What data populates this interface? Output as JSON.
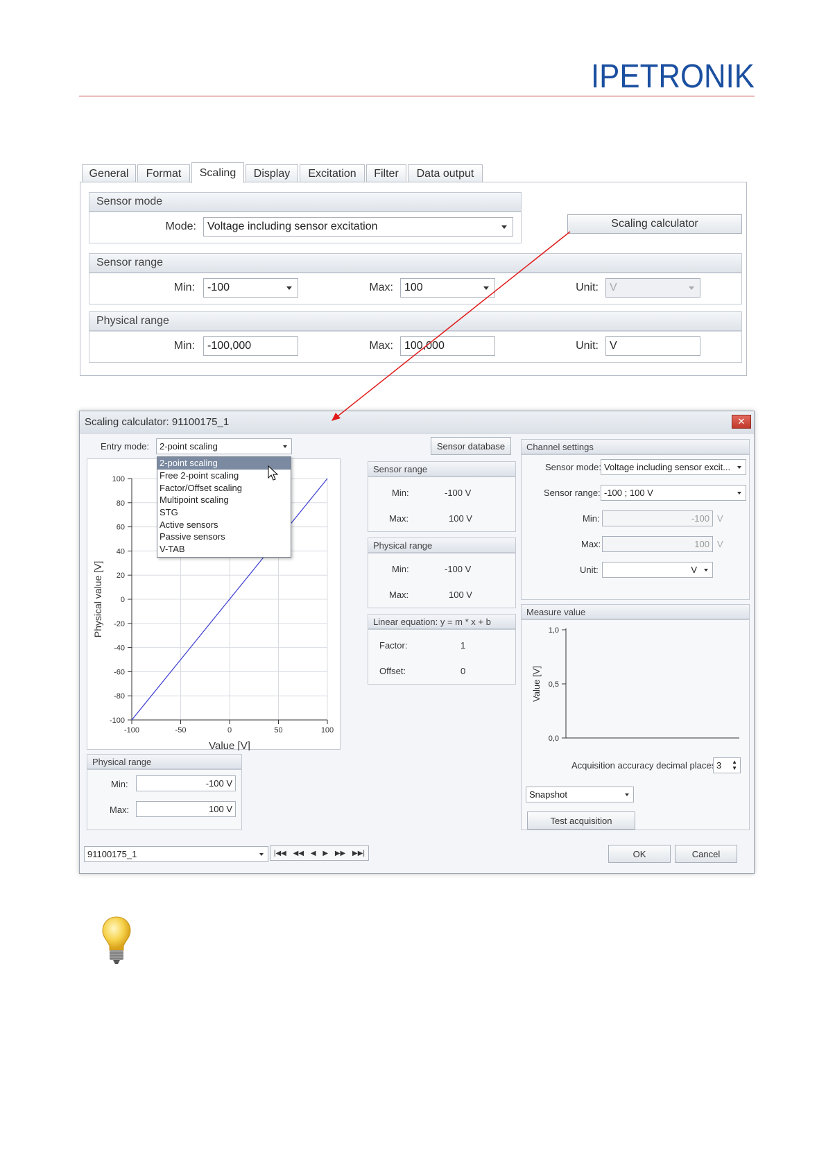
{
  "brand": {
    "logo_text": "IPETRONIK",
    "accent_color": "#1b4fa0",
    "rule_color": "#c44444"
  },
  "top_panel": {
    "tabs": [
      {
        "label": "General"
      },
      {
        "label": "Format"
      },
      {
        "label": "Scaling",
        "active": true
      },
      {
        "label": "Display"
      },
      {
        "label": "Excitation"
      },
      {
        "label": "Filter"
      },
      {
        "label": "Data output"
      }
    ],
    "sensor_mode": {
      "header": "Sensor mode",
      "mode_label": "Mode:",
      "mode_value": "Voltage including sensor excitation"
    },
    "scaling_calculator_button": "Scaling calculator",
    "sensor_range": {
      "header": "Sensor range",
      "min_label": "Min:",
      "min_value": "-100",
      "max_label": "Max:",
      "max_value": "100",
      "unit_label": "Unit:",
      "unit_value": "V"
    },
    "physical_range": {
      "header": "Physical range",
      "min_label": "Min:",
      "min_value": "-100,000",
      "max_label": "Max:",
      "max_value": "100,000",
      "unit_label": "Unit:",
      "unit_value": "V"
    }
  },
  "dialog": {
    "title": "Scaling calculator: 91100175_1",
    "close_icon": "close-icon",
    "entry_mode": {
      "label": "Entry mode:",
      "value": "2-point scaling",
      "options": [
        "2-point scaling",
        "Free 2-point scaling",
        "Factor/Offset scaling",
        "Multipoint scaling",
        "STG",
        "Active sensors",
        "Passive sensors",
        "V-TAB"
      ],
      "selected_index": 0
    },
    "sensor_database_button": "Sensor database",
    "sensor_range": {
      "header": "Sensor range",
      "min_label": "Min:",
      "min_value": "-100 V",
      "max_label": "Max:",
      "max_value": "100 V"
    },
    "physical_range_mid": {
      "header": "Physical range",
      "min_label": "Min:",
      "min_value": "-100 V",
      "max_label": "Max:",
      "max_value": "100 V"
    },
    "linear_equation": {
      "header": "Linear equation: y = m * x + b",
      "factor_label": "Factor:",
      "factor_value": "1",
      "offset_label": "Offset:",
      "offset_value": "0"
    },
    "physical_range_bottom": {
      "header": "Physical range",
      "min_label": "Min:",
      "min_value": "-100 V",
      "max_label": "Max:",
      "max_value": "100 V"
    },
    "channel_settings": {
      "header": "Channel settings",
      "sensor_mode_label": "Sensor mode:",
      "sensor_mode_value": "Voltage including sensor excit...",
      "sensor_range_label": "Sensor range:",
      "sensor_range_value": "-100 ; 100 V",
      "min_label": "Min:",
      "min_value": "-100",
      "min_unit": "V",
      "max_label": "Max:",
      "max_value": "100",
      "max_unit": "V",
      "unit_label": "Unit:",
      "unit_value": "V"
    },
    "measure_value": {
      "header": "Measure value",
      "ylabel": "Value [V]",
      "y_ticks": [
        "1,0",
        "0,5",
        "0,0"
      ],
      "accuracy_label": "Acquisition accuracy decimal places:",
      "accuracy_value": "3",
      "snapshot_value": "Snapshot",
      "test_button": "Test acquisition"
    },
    "channel_select_value": "91100175_1",
    "nav_icons": [
      "first-icon",
      "prev-fast-icon",
      "prev-icon",
      "next-icon",
      "next-fast-icon",
      "last-icon"
    ],
    "ok_button": "OK",
    "cancel_button": "Cancel"
  },
  "chart_data": {
    "type": "line",
    "xlabel": "Value [V]",
    "ylabel": "Physical value [V]",
    "xlim": [
      -100,
      100
    ],
    "ylim": [
      -100,
      100
    ],
    "x_ticks": [
      -100,
      -50,
      0,
      50,
      100
    ],
    "y_ticks": [
      -100,
      -80,
      -60,
      -40,
      -20,
      0,
      20,
      40,
      60,
      80,
      100
    ],
    "grid": true,
    "series": [
      {
        "x": [
          -100,
          100
        ],
        "y": [
          -100,
          100
        ],
        "color": "#3a3ad0"
      }
    ]
  }
}
